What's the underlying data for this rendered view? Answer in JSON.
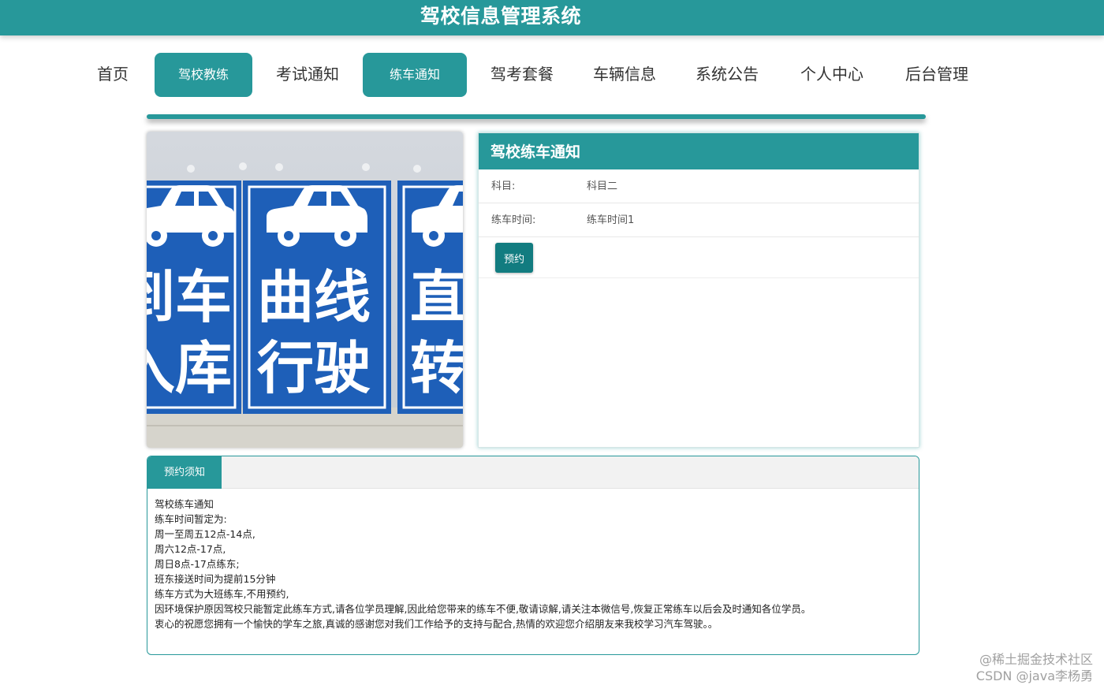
{
  "header": {
    "title": "驾校信息管理系统"
  },
  "nav": {
    "items": [
      {
        "label": "首页",
        "active": false
      },
      {
        "label": "驾校教练",
        "active": true
      },
      {
        "label": "考试通知",
        "active": false
      },
      {
        "label": "练车通知",
        "active": true
      },
      {
        "label": "驾考套餐",
        "active": false
      },
      {
        "label": "车辆信息",
        "active": false
      },
      {
        "label": "系统公告",
        "active": false
      },
      {
        "label": "个人中心",
        "active": false
      },
      {
        "label": "后台管理",
        "active": false
      }
    ]
  },
  "photo": {
    "signs": [
      "倒车入库",
      "曲线行驶",
      "直角转弯"
    ]
  },
  "notice": {
    "title": "驾校练车通知",
    "rows": [
      {
        "label": "科目:",
        "value": "科目二"
      },
      {
        "label": "练车时间:",
        "value": "练车时间1"
      }
    ],
    "button_label": "预约"
  },
  "tabs": {
    "active_label": "预约须知",
    "lines": [
      "驾校练车通知",
      "练车时间暂定为:",
      "周一至周五12点-14点,",
      "周六12点-17点,",
      "周日8点-17点练东;",
      "班东接送时间为提前15分钟",
      "练车方式为大班练车,不用预约,",
      "因环境保护原因驾校只能暂定此练车方式,请各位学员理解,因此给您带来的练车不便,敬请谅解,请关注本微信号,恢复正常练车以后会及时通知各位学员。",
      "衷心的祝愿您拥有一个愉快的学车之旅,真诚的感谢您对我们工作给予的支持与配合,热情的欢迎您介绍朋友来我校学习汽车驾驶。。"
    ]
  },
  "watermark": {
    "line1": "@稀土掘金技术社区",
    "line2": "CSDN @java李杨勇"
  },
  "colors": {
    "primary": "#27989a",
    "button": "#127c80",
    "sign_blue": "#1e5fb8"
  }
}
